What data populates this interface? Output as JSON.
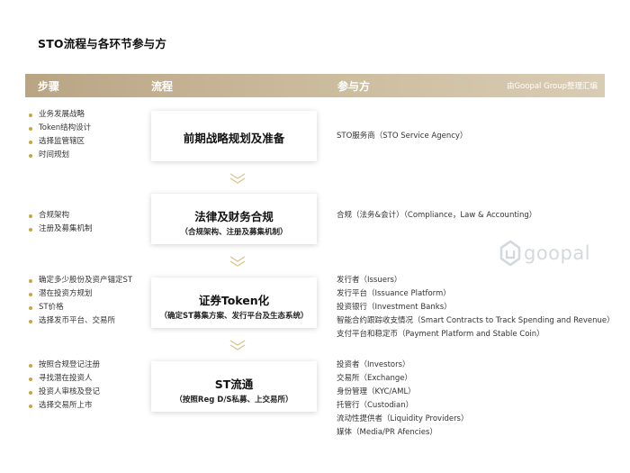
{
  "title": "STO流程与各环节参与方",
  "header": {
    "col_steps": "步骤",
    "col_process": "流程",
    "col_parties": "参与方",
    "note": "由Goopal Group整理汇编"
  },
  "rows": [
    {
      "steps": [
        "业务发展战略",
        "Token结构设计",
        "选择监管辖区",
        "时间规划"
      ],
      "process_main": "前期战略规划及准备",
      "process_sub": "",
      "parties": [
        "STO服务商（STO Service Agency）"
      ]
    },
    {
      "steps": [
        "合规架构",
        "注册及募集机制"
      ],
      "process_main": "法律及财务合规",
      "process_sub": "（合规架构、注册及募集机制）",
      "parties": [
        "合规（法务&会计）（Compliance，Law & Accounting）"
      ]
    },
    {
      "steps": [
        "确定多少股份及资产锚定ST",
        "潜在投资方规划",
        "ST价格",
        "选择发币平台、交易所"
      ],
      "process_main": "证券Token化",
      "process_sub": "（确定ST募集方案、发行平台及生态系统）",
      "parties": [
        "发行者（Issuers）",
        "发行平台（Issuance Platform）",
        "投资银行（Investment Banks）",
        "智能合约跟踪收支情况（Smart Contracts to Track Spending and Revenue）",
        "支付平台和稳定币（Payment Platform and Stable Coin）"
      ]
    },
    {
      "steps": [
        "按照合规登记注册",
        "寻找潜在投资人",
        "投资人审核及登记",
        "选择交易所上市"
      ],
      "process_main": "ST流通",
      "process_sub": "（按照Reg D/S私募、上交易所）",
      "parties": [
        "投资者（Investors）",
        "交易所（Exchange）",
        "身份管理（KYC/AML）",
        "托管行（Custodian）",
        "流动性提供者（Liquidity Providers）",
        "媒体（Media/PR Afencies）"
      ]
    }
  ],
  "logo": {
    "text": "goopal",
    "icon": "goopal-logo-icon"
  },
  "colors": {
    "header": "#c3b08f",
    "bullet": "#c7a83f",
    "chevron": "#d8c48a",
    "logo": "#d5d9dd"
  }
}
